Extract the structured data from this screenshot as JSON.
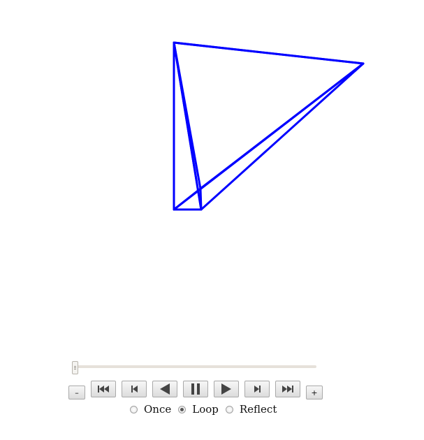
{
  "figure": {
    "line_color": "#0000ff",
    "shape": "tetrahedron-wireframe"
  },
  "animation": {
    "frame_slider_value": 0,
    "minus_label": "–",
    "plus_label": "+",
    "buttons": {
      "first": "first-frame-icon",
      "prev": "previous-frame-icon",
      "reverse": "reverse-play-icon",
      "pause": "pause-icon",
      "play": "play-icon",
      "next": "next-frame-icon",
      "last": "last-frame-icon"
    },
    "modes": [
      {
        "label": "Once",
        "checked": false
      },
      {
        "label": "Loop",
        "checked": true
      },
      {
        "label": "Reflect",
        "checked": false
      }
    ]
  }
}
